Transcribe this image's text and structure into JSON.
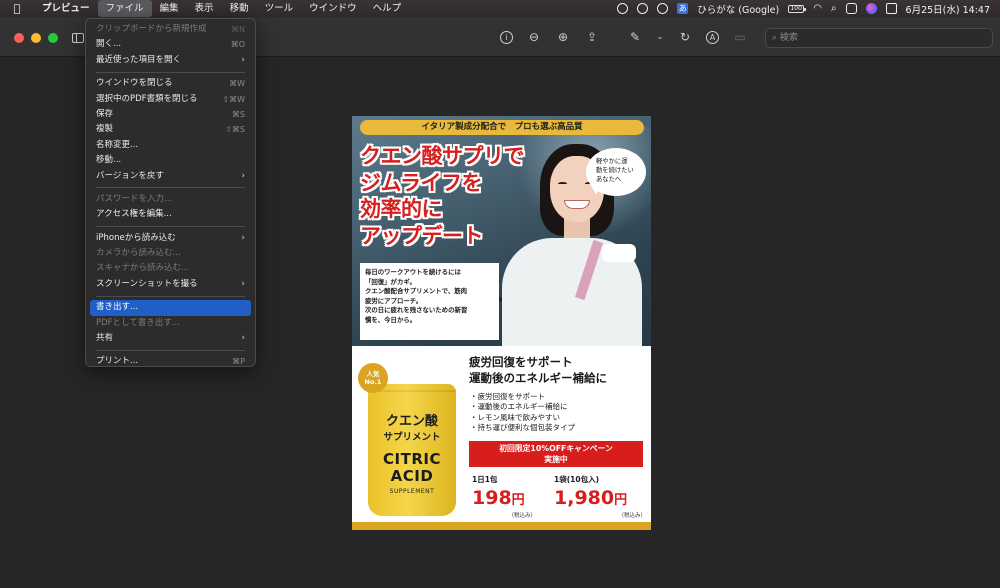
{
  "menubar": {
    "apple": "",
    "items": [
      "プレビュー",
      "ファイル",
      "編集",
      "表示",
      "移動",
      "ツール",
      "ウインドウ",
      "ヘルプ"
    ],
    "ime": "あ",
    "input_source": "ひらがな (Google)",
    "battery": "100",
    "clock": "6月25日(水) 14:47"
  },
  "toolbar": {
    "search_placeholder": "検索"
  },
  "file_menu": {
    "groups": [
      [
        {
          "label": "クリップボードから新規作成",
          "shortcut": "⌘N",
          "disabled": true
        },
        {
          "label": "開く...",
          "shortcut": "⌘O"
        },
        {
          "label": "最近使った項目を開く",
          "submenu": true
        }
      ],
      [
        {
          "label": "ウインドウを閉じる",
          "shortcut": "⌘W"
        },
        {
          "label": "選択中のPDF書類を閉じる",
          "shortcut": "⇧⌘W"
        },
        {
          "label": "保存",
          "shortcut": "⌘S"
        },
        {
          "label": "複製",
          "shortcut": "⇧⌘S"
        },
        {
          "label": "名称変更..."
        },
        {
          "label": "移動..."
        },
        {
          "label": "バージョンを戻す",
          "submenu": true
        }
      ],
      [
        {
          "label": "パスワードを入力...",
          "disabled": true
        },
        {
          "label": "アクセス権を編集..."
        }
      ],
      [
        {
          "label": "iPhoneから読み込む",
          "submenu": true
        },
        {
          "label": "カメラから読み込む...",
          "disabled": true
        },
        {
          "label": "スキャナから読み込む...",
          "disabled": true
        },
        {
          "label": "スクリーンショットを撮る",
          "submenu": true
        }
      ],
      [
        {
          "label": "書き出す...",
          "selected": true
        },
        {
          "label": "PDFとして書き出す...",
          "disabled": true
        },
        {
          "label": "共有",
          "submenu": true
        }
      ],
      [
        {
          "label": "プリント...",
          "shortcut": "⌘P"
        }
      ]
    ]
  },
  "flyer": {
    "top_banner": "イタリア製成分配合で　プロも選ぶ高品質",
    "headline": [
      "クエン酸サプリで",
      "ジムライフを",
      "効率的に",
      "アップデート"
    ],
    "bubble": [
      "軽やかに運",
      "動を続けたい",
      "あなたへ"
    ],
    "body_text": [
      "毎日のワークアウトを続けるには",
      "「回復」がカギ。",
      "クエン酸配合サプリメントで、筋肉",
      "疲労にアプローチ。",
      "次の日に疲れを残さないための新習",
      "慣を、今日から。"
    ],
    "badge": [
      "人気",
      "No.1"
    ],
    "pouch": {
      "jp_main": "クエン酸",
      "jp_sub": "サプリメント",
      "en_line1": "CITRIC",
      "en_line2": "ACID",
      "en_line3": "SUPPLEMENT"
    },
    "product_title": [
      "疲労回復をサポート",
      "運動後のエネルギー補給に"
    ],
    "features": [
      "・疲労回復をサポート",
      "・運動後のエネルギー補給に",
      "・レモン風味で飲みやすい",
      "・持ち運び便利な個包装タイプ"
    ],
    "campaign": [
      "初回限定10%OFFキャンペーン",
      "実施中"
    ],
    "prices": [
      {
        "label": "1日1包",
        "amount": "198",
        "unit": "円",
        "tax": "（税込み）"
      },
      {
        "label": "1袋(10包入)",
        "amount": "1,980",
        "unit": "円",
        "tax": "（税込み）"
      }
    ]
  }
}
